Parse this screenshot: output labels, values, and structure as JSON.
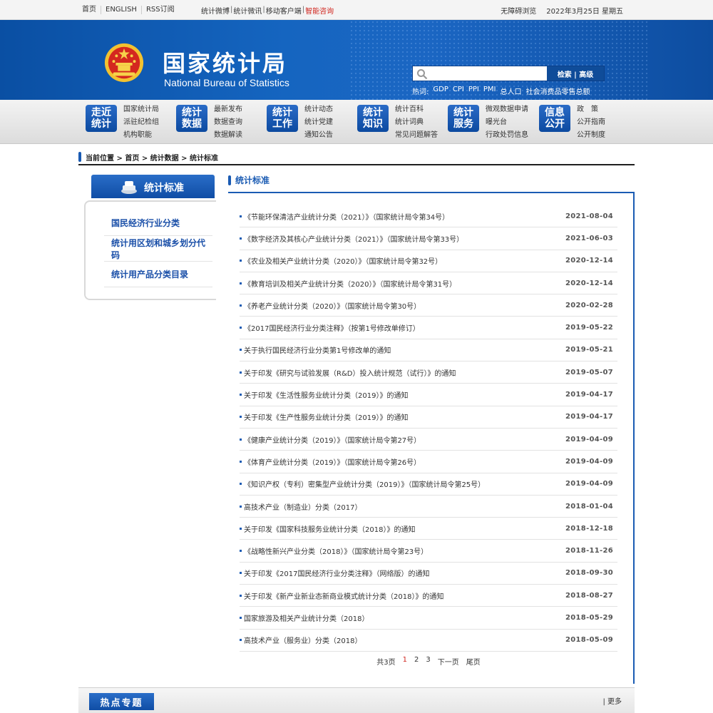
{
  "topbar": {
    "left_links": [
      "首页",
      "ENGLISH",
      "RSS订阅"
    ],
    "mid_links": [
      "统计微博",
      "统计微讯",
      "移动客户端"
    ],
    "mid_highlight": "智能咨询",
    "accessibility": "无障碍浏览",
    "date": "2022年3月25日 星期五"
  },
  "header": {
    "title_cn": "国家统计局",
    "title_en": "National Bureau of Statistics",
    "search_placeholder": "",
    "search_button": "检索 | 高级",
    "hot_label": "热词:",
    "hot_words": [
      "GDP",
      "CPI",
      "PPI",
      "PMI",
      "总人口",
      "社会消费品零售总额"
    ]
  },
  "nav": [
    {
      "badge": [
        "走近",
        "统计"
      ],
      "links": [
        "国家统计局",
        "派驻纪检组",
        "机构职能"
      ]
    },
    {
      "badge": [
        "统计",
        "数据"
      ],
      "links": [
        "最新发布",
        "数据查询",
        "数据解读"
      ]
    },
    {
      "badge": [
        "统计",
        "工作"
      ],
      "links": [
        "统计动态",
        "统计党建",
        "通知公告"
      ]
    },
    {
      "badge": [
        "统计",
        "知识"
      ],
      "links": [
        "统计百科",
        "统计词典",
        "常见问题解答"
      ]
    },
    {
      "badge": [
        "统计",
        "服务"
      ],
      "links": [
        "微观数据申请",
        "曝光台",
        "行政处罚信息"
      ]
    },
    {
      "badge": [
        "信息",
        "公开"
      ],
      "links": [
        "政　策",
        "公开指南",
        "公开制度"
      ]
    }
  ],
  "breadcrumb": "当前位置 > 首页 > 统计数据 > 统计标准",
  "sidebar": {
    "title": "统计标准",
    "items": [
      "国民经济行业分类",
      "统计用区划和城乡划分代码",
      "统计用产品分类目录"
    ]
  },
  "panel": {
    "title": "统计标准",
    "rows": [
      {
        "title": "《节能环保清洁产业统计分类（2021）》（国家统计局令第34号）",
        "date": "2021-08-04"
      },
      {
        "title": "《数字经济及其核心产业统计分类（2021）》（国家统计局令第33号）",
        "date": "2021-06-03"
      },
      {
        "title": "《农业及相关产业统计分类（2020）》（国家统计局令第32号）",
        "date": "2020-12-14"
      },
      {
        "title": "《教育培训及相关产业统计分类（2020）》（国家统计局令第31号）",
        "date": "2020-12-14"
      },
      {
        "title": "《养老产业统计分类（2020）》（国家统计局令第30号）",
        "date": "2020-02-28"
      },
      {
        "title": "《2017国民经济行业分类注释》（按第1号修改单修订）",
        "date": "2019-05-22"
      },
      {
        "title": "关于执行国民经济行业分类第1号修改单的通知",
        "date": "2019-05-21"
      },
      {
        "title": "关于印发《研究与试验发展（R&D）投入统计规范（试行）》的通知",
        "date": "2019-05-07"
      },
      {
        "title": "关于印发《生活性服务业统计分类（2019）》的通知",
        "date": "2019-04-17"
      },
      {
        "title": "关于印发《生产性服务业统计分类（2019）》的通知",
        "date": "2019-04-17"
      },
      {
        "title": "《健康产业统计分类（2019）》（国家统计局令第27号）",
        "date": "2019-04-09"
      },
      {
        "title": "《体育产业统计分类（2019）》（国家统计局令第26号）",
        "date": "2019-04-09"
      },
      {
        "title": "《知识产权（专利）密集型产业统计分类（2019）》（国家统计局令第25号）",
        "date": "2019-04-09"
      },
      {
        "title": "高技术产业（制造业）分类（2017）",
        "date": "2018-01-04"
      },
      {
        "title": "关于印发《国家科技服务业统计分类（2018）》的通知",
        "date": "2018-12-18"
      },
      {
        "title": "《战略性新兴产业分类（2018）》（国家统计局令第23号）",
        "date": "2018-11-26"
      },
      {
        "title": "关于印发《2017国民经济行业分类注释》（网络版）的通知",
        "date": "2018-09-30"
      },
      {
        "title": "关于印发《新产业新业态新商业模式统计分类（2018）》的通知",
        "date": "2018-08-27"
      },
      {
        "title": "国家旅游及相关产业统计分类（2018）",
        "date": "2018-05-29"
      },
      {
        "title": "高技术产业（服务业）分类（2018）",
        "date": "2018-05-09"
      }
    ],
    "pager": {
      "total": "共3页",
      "pages": [
        "1",
        "2",
        "3"
      ],
      "current": "1",
      "next": "下一页",
      "last": "尾页"
    }
  },
  "bottom": {
    "tab": "热点专题",
    "more": "| 更多"
  },
  "colors": {
    "brand_blue": "#0f4da5",
    "accent_red": "#d0261f"
  }
}
